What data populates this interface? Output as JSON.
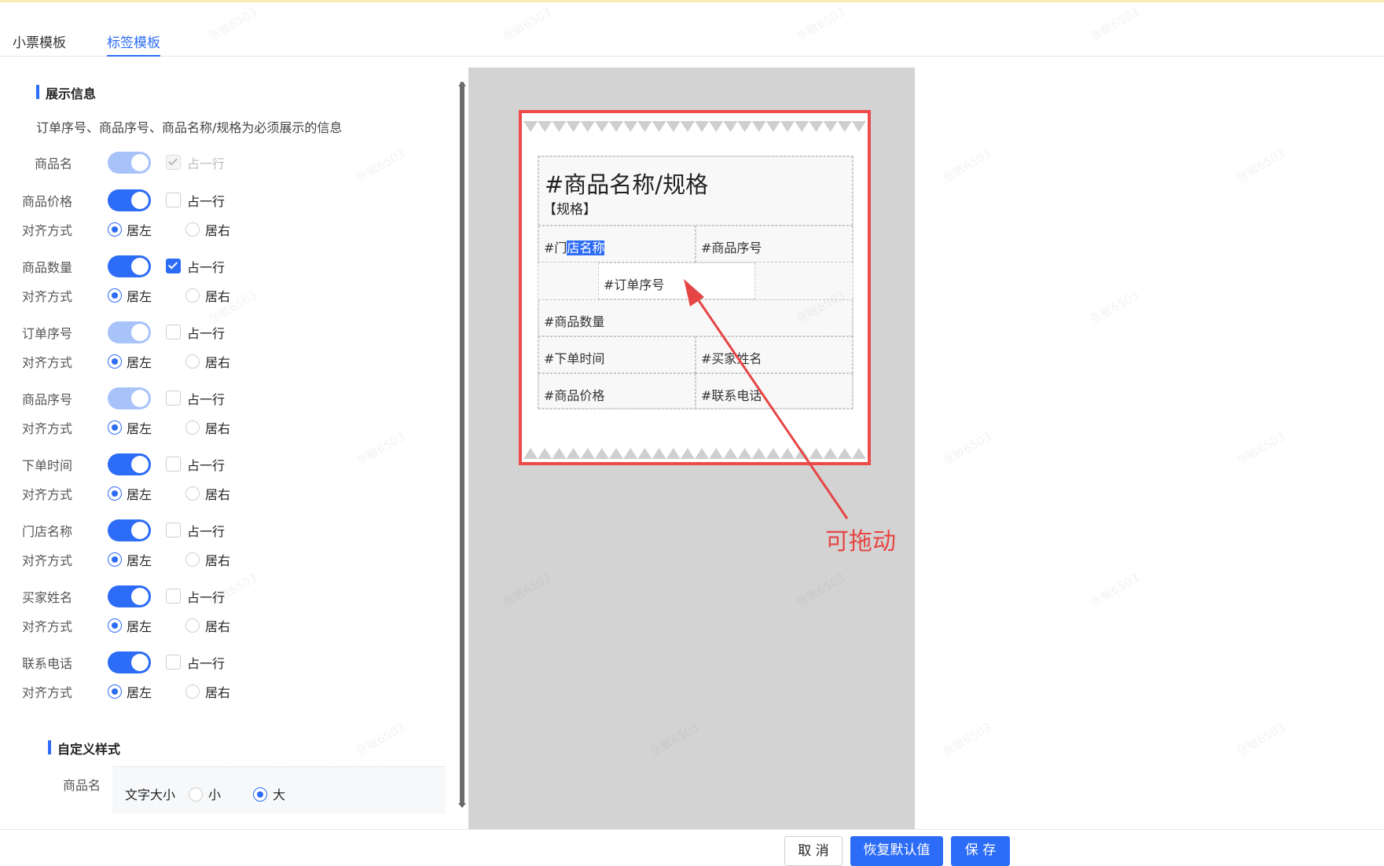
{
  "tabs": [
    {
      "label": "小票模板",
      "active": false
    },
    {
      "label": "标签模板",
      "active": true
    }
  ],
  "display_section": {
    "title": "展示信息",
    "hint": "订单序号、商品序号、商品名称/规格为必须展示的信息"
  },
  "fields": [
    {
      "label": "商品名",
      "enabled": true,
      "locked": true,
      "full_row_label": "占一行",
      "full_row": true,
      "full_row_locked": true
    },
    {
      "label": "商品价格",
      "enabled": true,
      "locked": false,
      "full_row_label": "占一行",
      "full_row": false
    },
    {
      "label": "商品数量",
      "enabled": true,
      "locked": false,
      "full_row_label": "占一行",
      "full_row": true
    },
    {
      "label": "订单序号",
      "enabled": true,
      "locked": true,
      "full_row_label": "占一行",
      "full_row": false
    },
    {
      "label": "商品序号",
      "enabled": true,
      "locked": true,
      "full_row_label": "占一行",
      "full_row": false
    },
    {
      "label": "下单时间",
      "enabled": true,
      "locked": false,
      "full_row_label": "占一行",
      "full_row": false
    },
    {
      "label": "门店名称",
      "enabled": true,
      "locked": false,
      "full_row_label": "占一行",
      "full_row": false
    },
    {
      "label": "买家姓名",
      "enabled": true,
      "locked": false,
      "full_row_label": "占一行",
      "full_row": false
    },
    {
      "label": "联系电话",
      "enabled": true,
      "locked": false,
      "full_row_label": "占一行",
      "full_row": false
    }
  ],
  "align": {
    "label": "对齐方式",
    "left": "居左",
    "right": "居右",
    "selected": "left"
  },
  "custom_section": {
    "title": "自定义样式",
    "item_label": "商品名",
    "font_size_label": "文字大小",
    "small": "小",
    "large": "大",
    "selected": "large"
  },
  "preview": {
    "title": "#商品名称/规格",
    "spec": "【规格】",
    "store_prefix": "#门",
    "store_highlight": "店名称",
    "product_no": "#商品序号",
    "order_no": "#订单序号",
    "quantity": "#商品数量",
    "order_time": "#下单时间",
    "buyer_name": "#买家姓名",
    "price": "#商品价格",
    "phone": "#联系电话"
  },
  "annotation": {
    "text": "可拖动",
    "color": "#e64545"
  },
  "footer": {
    "cancel": "取 消",
    "reset": "恢复默认值",
    "save": "保 存"
  },
  "colors": {
    "accent": "#2d6cf6",
    "frame": "#ee4a4a",
    "preview_bg": "#d3d3d3"
  },
  "watermark": "张敏6503"
}
